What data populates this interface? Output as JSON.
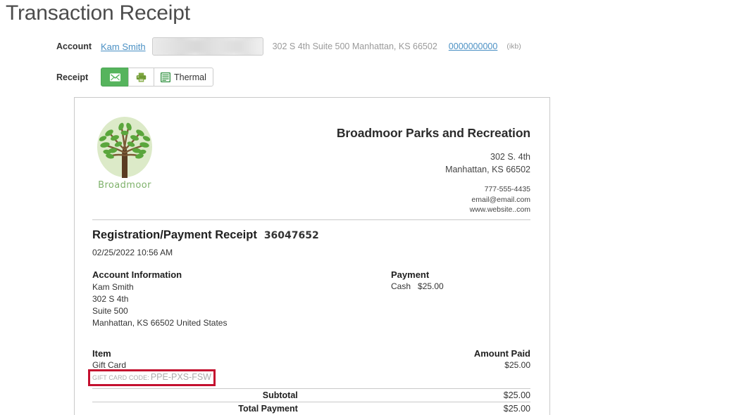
{
  "page": {
    "title": "Transaction Receipt"
  },
  "account_row": {
    "label": "Account",
    "name": "Kam Smith",
    "search_value": "",
    "search_placeholder": "",
    "address": "302 S 4th Suite 500 Manhattan, KS 66502",
    "phone": "0000000000",
    "code": "(ikb)"
  },
  "receipt_row": {
    "label": "Receipt",
    "email_button": "",
    "print_button": "",
    "thermal_button": "Thermal",
    "email_color": "#56b45d"
  },
  "receipt": {
    "logo_word": "Broadmoor",
    "org_name": "Broadmoor Parks and Recreation",
    "org_address_line1": "302 S. 4th",
    "org_address_line2": "Manhattan, KS 66502",
    "org_phone": "777-555-4435",
    "org_email": "email@email.com",
    "org_website": "www.website..com",
    "title": "Registration/Payment Receipt",
    "number": "36047652",
    "datetime": "02/25/2022 10:56 AM",
    "account_info": {
      "heading": "Account Information",
      "lines": [
        "Kam Smith",
        "302 S 4th",
        "Suite 500",
        "Manhattan, KS 66502 United States"
      ]
    },
    "payment": {
      "heading": "Payment",
      "method": "Cash",
      "amount": "$25.00"
    },
    "items": {
      "col_item": "Item",
      "col_amount": "Amount Paid",
      "rows": [
        {
          "name": "Gift Card",
          "amount": "$25.00"
        }
      ],
      "gift_card_label": "GIFT CARD CODE:",
      "gift_card_code": "PPE-PXS-FSW",
      "highlight_color": "#c4102f"
    },
    "totals": [
      {
        "label": "Subtotal",
        "value": "$25.00"
      },
      {
        "label": "Total Payment",
        "value": "$25.00"
      }
    ]
  }
}
